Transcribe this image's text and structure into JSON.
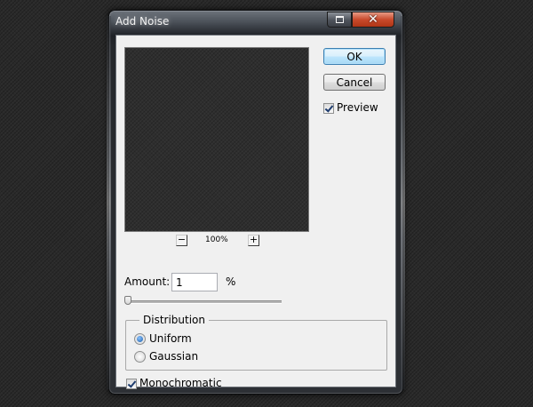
{
  "window": {
    "title": "Add Noise"
  },
  "buttons": {
    "ok": "OK",
    "cancel": "Cancel",
    "zoom_out": "−",
    "zoom_in": "+"
  },
  "preview": {
    "label": "Preview",
    "checked": true,
    "zoom": "100%"
  },
  "amount": {
    "label": "Amount:",
    "value": "1",
    "unit": "%",
    "slider_fraction": 0.0
  },
  "distribution": {
    "title": "Distribution",
    "options": [
      {
        "label": "Uniform",
        "selected": true
      },
      {
        "label": "Gaussian",
        "selected": false
      }
    ]
  },
  "monochromatic": {
    "label": "Monochromatic",
    "checked": true
  },
  "caption_buttons": {
    "restore_icon": "restore-icon",
    "close_icon": "close-icon",
    "close_glyph": "✕"
  }
}
